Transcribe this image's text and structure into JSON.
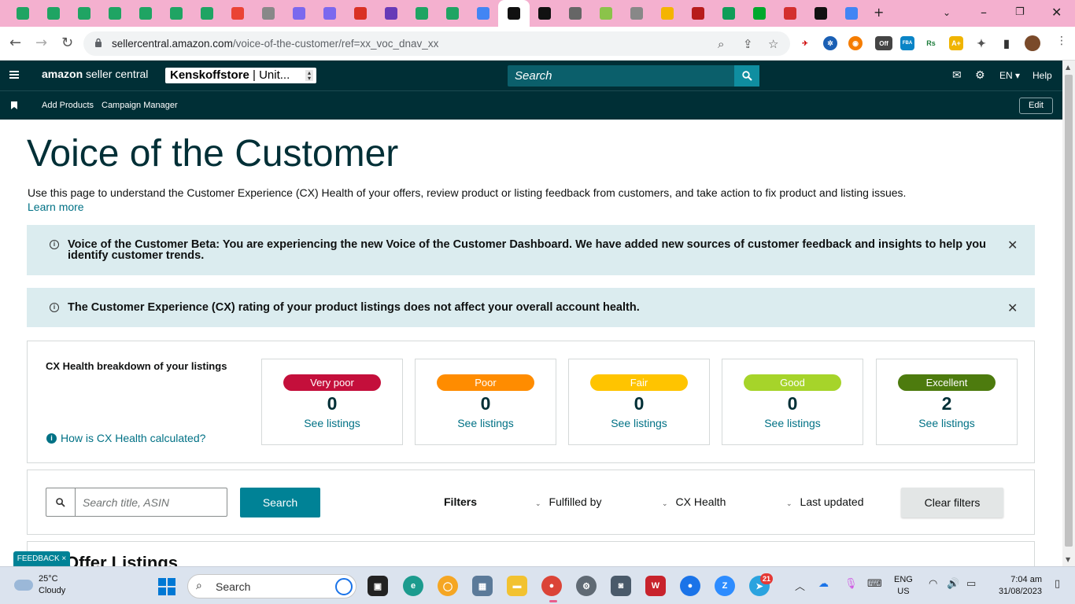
{
  "browser": {
    "tab_count_icons": [
      "sheets",
      "sheets",
      "sheets",
      "sheets",
      "sheets",
      "sheets",
      "sheets",
      "gmail",
      "tab",
      "clickup",
      "clickup",
      "vector",
      "forms",
      "sheets",
      "sheets",
      "google",
      "amazon",
      "amazon",
      "globe",
      "plant",
      "tab",
      "apps",
      "vw",
      "puzzle",
      "evernote",
      "big",
      "amazon",
      "google"
    ],
    "new_tab_symbol": "+",
    "url_host": "sellercentral.amazon.com",
    "url_path": "/voice-of-the-customer/ref=xx_voc_dnav_xx",
    "ext_off_badge": "Off"
  },
  "header": {
    "logo_bold": "amazon",
    "logo_rest": " seller central",
    "store_name": "Kenskoffstore",
    "store_market": " | Unit...",
    "search_placeholder": "Search",
    "language": "EN",
    "help": "Help",
    "sub_links": [
      "Add Products",
      "Campaign Manager"
    ],
    "edit_label": "Edit"
  },
  "page": {
    "title": "Voice of the Customer",
    "description": "Use this page to understand the Customer Experience (CX) Health of your offers, review product or listing feedback from customers, and take action to fix product and listing issues.",
    "learn_more": "Learn more",
    "alerts": [
      {
        "text": "Voice of the Customer Beta: You are experiencing the new Voice of the Customer Dashboard. We have added new sources of customer feedback and insights to help you identify customer trends."
      },
      {
        "text": "The Customer Experience (CX) rating of your product listings does not affect your overall account health."
      }
    ],
    "cx_health": {
      "title": "CX Health breakdown of your listings",
      "how_link": "How is CX Health calculated?",
      "cards": [
        {
          "label": "Very poor",
          "count": "0",
          "link": "See listings",
          "color": "#c40f3b"
        },
        {
          "label": "Poor",
          "count": "0",
          "link": "See listings",
          "color": "#ff8c00"
        },
        {
          "label": "Fair",
          "count": "0",
          "link": "See listings",
          "color": "#ffc400"
        },
        {
          "label": "Good",
          "count": "0",
          "link": "See listings",
          "color": "#a6d42a"
        },
        {
          "label": "Excellent",
          "count": "2",
          "link": "See listings",
          "color": "#4d7b0e"
        }
      ]
    },
    "search": {
      "placeholder": "Search title, ASIN",
      "button": "Search",
      "filters_label": "Filters",
      "filters": [
        "Fulfilled by",
        "CX Health",
        "Last updated"
      ],
      "clear": "Clear filters"
    },
    "offer_listings_title": "Offer Listings",
    "feedback_tab": "FEEDBACK ×"
  },
  "taskbar": {
    "temp": "25°C",
    "condition": "Cloudy",
    "search_placeholder": "Search",
    "telegram_badge": "21",
    "lang_top": "ENG",
    "lang_bottom": "US",
    "time": "7:04 am",
    "date": "31/08/2023"
  }
}
